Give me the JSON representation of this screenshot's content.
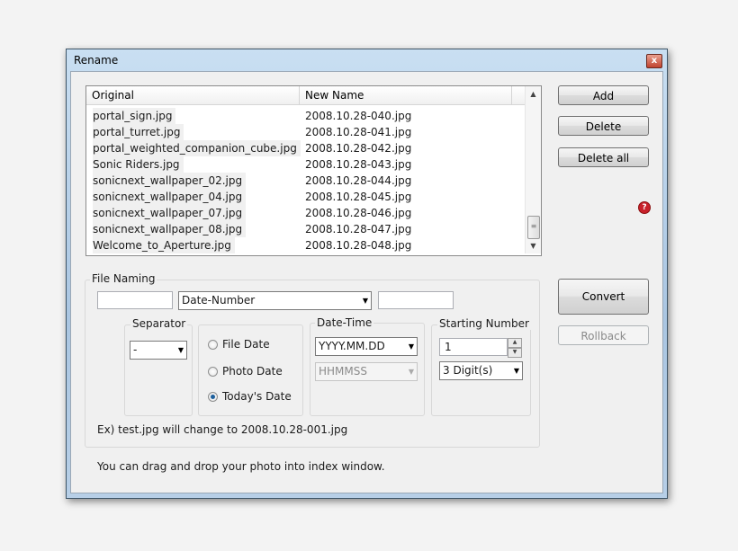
{
  "window": {
    "title": "Rename",
    "close_label": "x"
  },
  "list": {
    "columns": [
      "Original",
      "New Name"
    ],
    "rows": [
      {
        "original": "portal_sign.jpg",
        "new_name": "2008.10.28-040.jpg"
      },
      {
        "original": "portal_turret.jpg",
        "new_name": "2008.10.28-041.jpg"
      },
      {
        "original": "portal_weighted_companion_cube.jpg",
        "new_name": "2008.10.28-042.jpg"
      },
      {
        "original": "Sonic Riders.jpg",
        "new_name": "2008.10.28-043.jpg"
      },
      {
        "original": "sonicnext_wallpaper_02.jpg",
        "new_name": "2008.10.28-044.jpg"
      },
      {
        "original": "sonicnext_wallpaper_04.jpg",
        "new_name": "2008.10.28-045.jpg"
      },
      {
        "original": "sonicnext_wallpaper_07.jpg",
        "new_name": "2008.10.28-046.jpg"
      },
      {
        "original": "sonicnext_wallpaper_08.jpg",
        "new_name": "2008.10.28-047.jpg"
      },
      {
        "original": "Welcome_to_Aperture.jpg",
        "new_name": "2008.10.28-048.jpg"
      }
    ]
  },
  "buttons": {
    "add": "Add",
    "delete": "Delete",
    "delete_all": "Delete all",
    "convert": "Convert",
    "rollback": "Rollback",
    "help": "?"
  },
  "file_naming": {
    "label": "File Naming",
    "prefix_value": "",
    "mode_selected": "Date-Number",
    "suffix_value": "",
    "separator": {
      "label": "Separator",
      "selected": "-"
    },
    "date_source": {
      "options": [
        "File Date",
        "Photo Date",
        "Today's Date"
      ],
      "selected": "Today's Date"
    },
    "date_time": {
      "label": "Date-Time",
      "date_format": "YYYY.MM.DD",
      "time_format": "HHMMSS"
    },
    "starting_number": {
      "label": "Starting Number",
      "value": "1",
      "digits": "3 Digit(s)"
    },
    "example": "Ex) test.jpg will change to 2008.10.28-001.jpg"
  },
  "footer_hint": "You can drag and drop your photo into index window."
}
